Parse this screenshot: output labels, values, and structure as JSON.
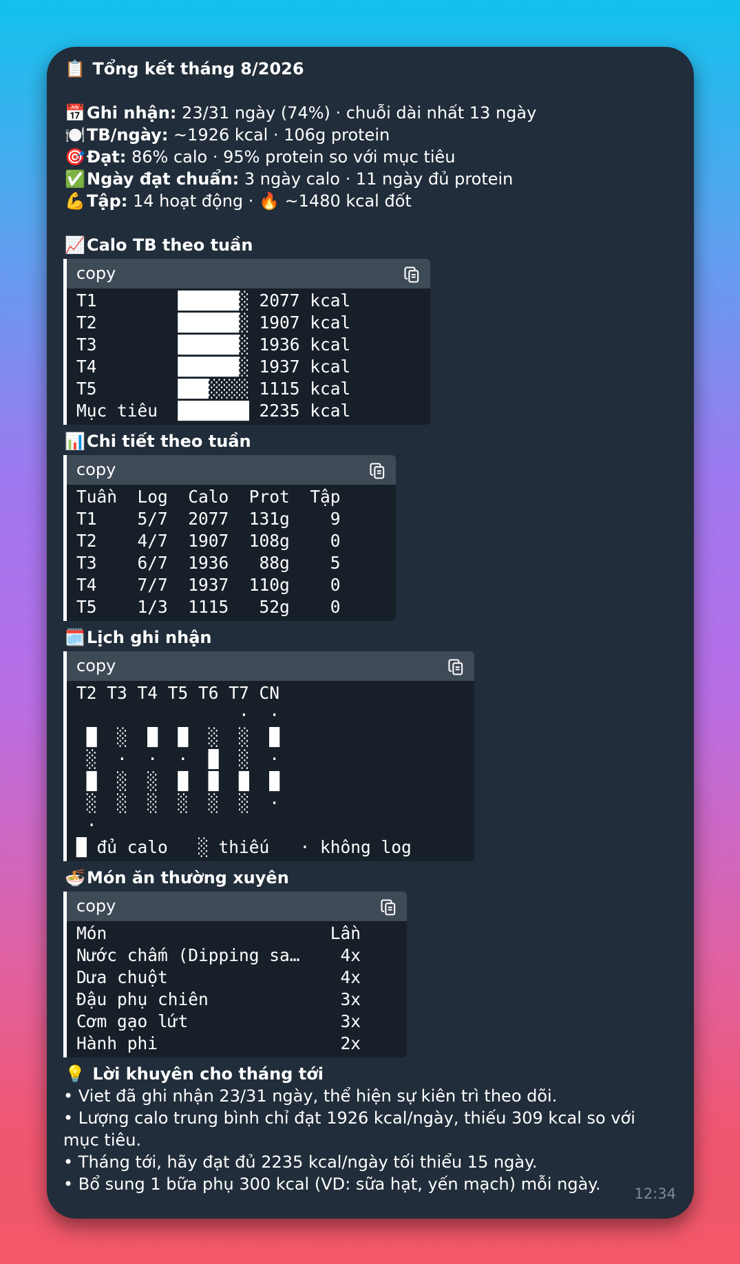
{
  "message": {
    "title": "Tổng kết tháng 8/2026",
    "title_emoji": "📋",
    "stats": [
      {
        "emoji": "📅",
        "label": "Ghi nhận:",
        "text": " 23/31 ngày (74%) · chuỗi dài nhất 13 ngày"
      },
      {
        "emoji": "🍽️",
        "label": "TB/ngày:",
        "text": " ~1926 kcal · 106g protein"
      },
      {
        "emoji": "🎯",
        "label": "Đạt:",
        "text": " 86% calo · 95% protein so với mục tiêu"
      },
      {
        "emoji": "✅",
        "label": "Ngày đạt chuẩn:",
        "text": " 3 ngày calo · 11 ngày đủ protein"
      },
      {
        "emoji": "💪",
        "label": "Tập:",
        "text": " 14 hoạt động · 🔥 ~1480 kcal đốt"
      }
    ],
    "sections": [
      {
        "emoji": "📈",
        "title": "Calo TB theo tuần",
        "copy_label": "copy",
        "width": 528,
        "code": "T1        ██████░ 2077 kcal\nT2        ██████░ 1907 kcal\nT3        ██████░ 1936 kcal\nT4        ██████░ 1937 kcal\nT5        ███░░░░ 1115 kcal\nMục tiêu  ███████ 2235 kcal"
      },
      {
        "emoji": "📊",
        "title": "Chi tiết theo tuần",
        "copy_label": "copy",
        "width": 478,
        "code": "Tuần  Log  Calo  Prot  Tập\nT1    5/7  2077  131g    9\nT2    4/7  1907  108g    0\nT3    6/7  1936   88g    5\nT4    7/7  1937  110g    0\nT5    1/3  1115   52g    0"
      },
      {
        "emoji": "🗓️",
        "title": "Lịch ghi nhận",
        "copy_label": "copy",
        "width": 592,
        "code": "T2 T3 T4 T5 T6 T7 CN\n                ·  ·\n █  ░  █  █  ░  ░  █\n ░  ·  ·  ·  █  ░  ·\n █  ░  ░  █  █  █  █\n ░  ░  ░  ░  ░  ░  ·\n ·\n█ đủ calo   ░ thiếu   · không log"
      },
      {
        "emoji": "🍜",
        "title": "Món ăn thường xuyên",
        "copy_label": "copy",
        "width": 494,
        "code": "Món                      Lần\nNước chấm (Dipping sa…    4x\nDưa chuột                 4x\nĐậu phụ chiên             3x\nCơm gạo lứt               3x\nHành phi                  2x"
      }
    ],
    "advice": {
      "emoji": "💡",
      "title": "Lời khuyên cho tháng tới",
      "items": [
        "• Viet đã ghi nhận 23/31 ngày, thể hiện sự kiên trì theo dõi.",
        "• Lượng calo trung bình chỉ đạt 1926 kcal/ngày, thiếu 309 kcal so với mục tiêu.",
        "• Tháng tới, hãy đạt đủ 2235 kcal/ngày tối thiểu 15 ngày.",
        "• Bổ sung 1 bữa phụ 300 kcal (VD: sữa hạt, yến mạch) mỗi ngày."
      ]
    },
    "time": "12:34"
  }
}
